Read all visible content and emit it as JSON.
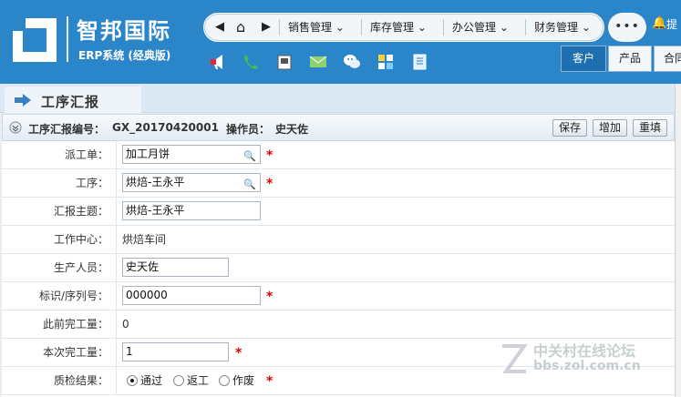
{
  "app": {
    "brand": "智邦国际",
    "subtitle": "ERP系统 (经典版)"
  },
  "nav": {
    "items": [
      "销售管理",
      "库存管理",
      "办公管理",
      "财务管理"
    ],
    "more": "•••",
    "tip": "提"
  },
  "quick_icons": [
    "megaphone-icon",
    "phone-icon",
    "fax-icon",
    "mail-icon",
    "wechat-icon",
    "grid-icon",
    "document-icon"
  ],
  "tabs": [
    "客户",
    "产品",
    "合同"
  ],
  "page": {
    "title": "工序汇报"
  },
  "info": {
    "code_label": "工序汇报编号：",
    "code_value": "GX_20170420001",
    "operator_label": "操作员：",
    "operator_value": "史天佐",
    "buttons": [
      "保存",
      "增加",
      "重填"
    ]
  },
  "form": {
    "dispatch": {
      "label": "派工单：",
      "value": "加工月饼"
    },
    "process": {
      "label": "工序：",
      "value": "烘焙-王永平"
    },
    "subject": {
      "label": "汇报主题：",
      "value": "烘焙-王永平"
    },
    "center": {
      "label": "工作中心：",
      "value": "烘焙车间"
    },
    "worker": {
      "label": "生产人员：",
      "value": "史天佐"
    },
    "serial": {
      "label": "标识/序列号：",
      "value": "000000"
    },
    "prev_done": {
      "label": "此前完工量：",
      "value": "0"
    },
    "this_done": {
      "label": "本次完工量：",
      "value": "1"
    },
    "qc": {
      "label": "质检结果：",
      "options": [
        "通过",
        "返工",
        "作废"
      ],
      "selected": "通过"
    }
  },
  "required_mark": "*",
  "watermark": {
    "line1": "中关村在线论坛",
    "line2": "bbs.zol.com.cn"
  },
  "colors": {
    "header_bg": "#2b85c9",
    "tab_active": "#1d6fb0",
    "required": "#d00000"
  }
}
